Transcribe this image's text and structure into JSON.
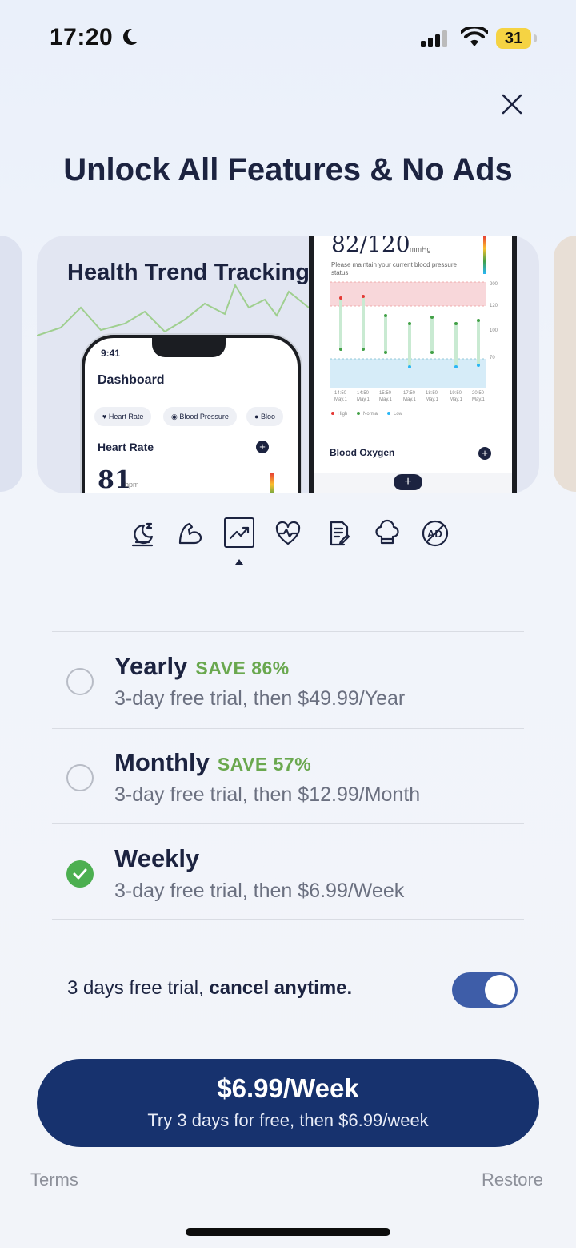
{
  "status_bar": {
    "time": "17:20",
    "battery": "31"
  },
  "title": "Unlock All Features & No Ads",
  "carousel": {
    "card_title": "Health Trend Tracking",
    "phone_left": {
      "time": "9:41",
      "dashboard": "Dashboard",
      "chips": [
        "Heart Rate",
        "Blood Pressure",
        "Bloo"
      ],
      "section": "Heart Rate",
      "value": "81",
      "unit": "bpm"
    },
    "phone_right": {
      "value": "82/120",
      "unit": "mmHg",
      "note": "Please maintain your current blood pressure status",
      "y_ticks": [
        "200",
        "120",
        "100",
        "70"
      ],
      "x_ticks": [
        "14:50",
        "14:50",
        "15:50",
        "17:50",
        "18:50",
        "19:50",
        "20:50"
      ],
      "x_sub": "May,1",
      "legend": [
        "High",
        "Normal",
        "Low"
      ],
      "section": "Blood Oxygen"
    }
  },
  "feature_icons": [
    "sleep-icon",
    "muscle-icon",
    "trend-icon",
    "heart-rate-icon",
    "report-icon",
    "chef-icon",
    "no-ads-icon"
  ],
  "plans": [
    {
      "name": "Yearly",
      "save": "SAVE 86%",
      "desc": "3-day free trial, then $49.99/Year",
      "selected": false
    },
    {
      "name": "Monthly",
      "save": "SAVE 57%",
      "desc": "3-day free trial, then $12.99/Month",
      "selected": false
    },
    {
      "name": "Weekly",
      "save": "",
      "desc": "3-day free trial, then $6.99/Week",
      "selected": true
    }
  ],
  "trial_toggle": {
    "prefix": "3 days free trial, ",
    "bold": "cancel anytime.",
    "on": true
  },
  "cta": {
    "price": "$6.99/Week",
    "sub": "Try 3 days for free, then $6.99/week"
  },
  "footer": {
    "terms": "Terms",
    "restore": "Restore"
  },
  "colors": {
    "primary": "#17326e",
    "accent_green": "#6aa84f",
    "check_green": "#4caf50",
    "toggle": "#3e5da8"
  }
}
